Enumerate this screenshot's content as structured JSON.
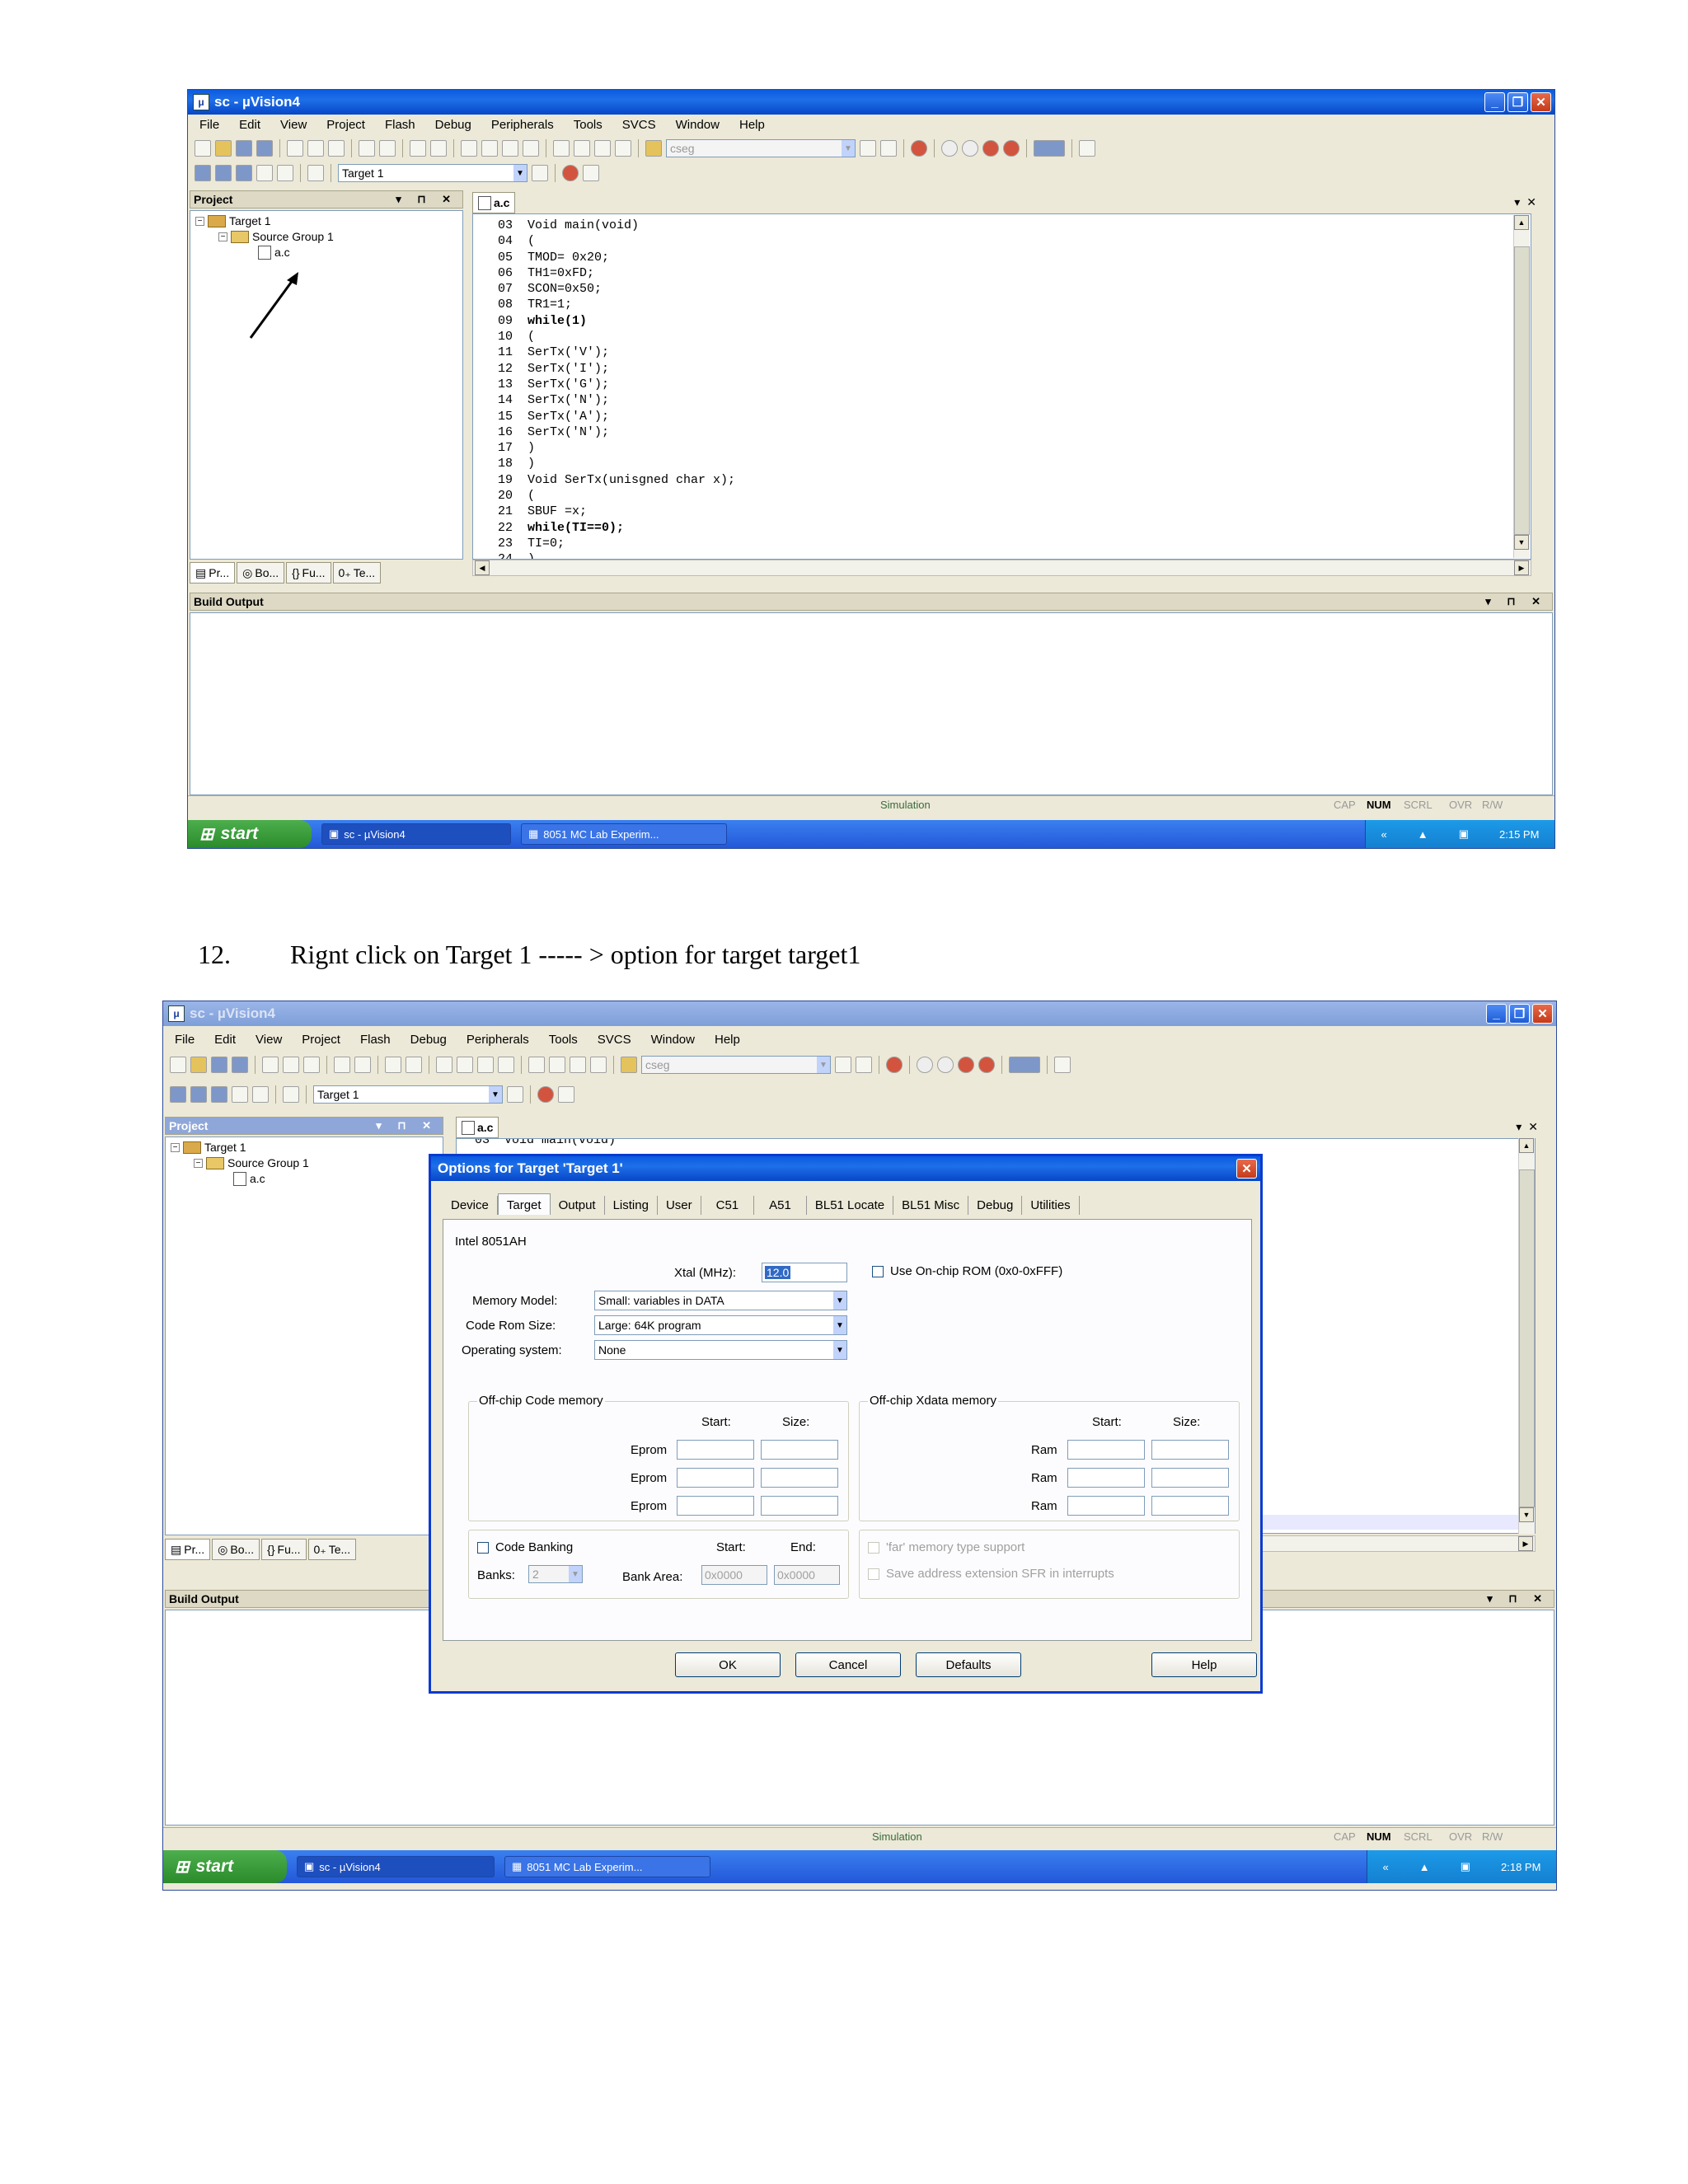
{
  "window": {
    "app_label": "sc",
    "title": "µVision4",
    "icon": "uvision-app-icon"
  },
  "menu": [
    "File",
    "Edit",
    "View",
    "Project",
    "Flash",
    "Debug",
    "Peripherals",
    "Tools",
    "SVCS",
    "Window",
    "Help"
  ],
  "toolbar": {
    "find_combo": "cseg",
    "target_combo": "Target 1"
  },
  "project_pane": {
    "title": "Project",
    "tree": {
      "target": "Target 1",
      "group": "Source Group 1",
      "file": "a.c"
    },
    "tabs": [
      "Pr...",
      "Bo...",
      "Fu...",
      "Te..."
    ]
  },
  "editor": {
    "tab": "a.c",
    "lines": [
      {
        "n": "03",
        "t": "Void main(void)"
      },
      {
        "n": "04",
        "t": "("
      },
      {
        "n": "05",
        "t": "TMOD= 0x20;"
      },
      {
        "n": "06",
        "t": "TH1=0xFD;"
      },
      {
        "n": "07",
        "t": "SCON=0x50;"
      },
      {
        "n": "08",
        "t": "TR1=1;"
      },
      {
        "n": "09",
        "t": "while(1)"
      },
      {
        "n": "10",
        "t": "("
      },
      {
        "n": "11",
        "t": "SerTx('V');"
      },
      {
        "n": "12",
        "t": "SerTx('I');"
      },
      {
        "n": "13",
        "t": "SerTx('G');"
      },
      {
        "n": "14",
        "t": "SerTx('N');"
      },
      {
        "n": "15",
        "t": "SerTx('A');"
      },
      {
        "n": "16",
        "t": "SerTx('N');"
      },
      {
        "n": "17",
        "t": ")"
      },
      {
        "n": "18",
        "t": ")"
      },
      {
        "n": "19",
        "t": "Void SerTx(unisgned char x);"
      },
      {
        "n": "20",
        "t": "("
      },
      {
        "n": "21",
        "t": "SBUF =x;"
      },
      {
        "n": "22",
        "t": "while(TI==0);"
      },
      {
        "n": "23",
        "t": "TI=0;"
      },
      {
        "n": "24",
        "t": ")"
      }
    ],
    "peek_line": "03  Void main(void)"
  },
  "build_output": {
    "title": "Build Output"
  },
  "status": {
    "mode": "Simulation",
    "indicators": [
      "CAP",
      "NUM",
      "SCRL",
      "OVR",
      "R/W"
    ]
  },
  "taskbar": {
    "start": "start",
    "tasks": [
      "sc - µVision4",
      "8051 MC Lab Experim..."
    ],
    "clock1": "2:15 PM",
    "clock2": "2:18 PM"
  },
  "instruction": {
    "number": "12.",
    "text": "Rignt click on Target 1 ----- >  option for target target1"
  },
  "dialog": {
    "title": "Options for Target 'Target 1'",
    "tabs": [
      "Device",
      "Target",
      "Output",
      "Listing",
      "User",
      "C51",
      "A51",
      "BL51 Locate",
      "BL51 Misc",
      "Debug",
      "Utilities"
    ],
    "device": "Intel 8051AH",
    "xtal_label": "Xtal (MHz):",
    "xtal_value": "12.0",
    "use_onchip_rom": "Use On-chip ROM (0x0-0xFFF)",
    "memory_model_label": "Memory Model:",
    "memory_model": "Small: variables in DATA",
    "code_rom_label": "Code Rom Size:",
    "code_rom": "Large: 64K program",
    "os_label": "Operating system:",
    "os": "None",
    "offchip_code_title": "Off-chip Code memory",
    "offchip_xdata_title": "Off-chip Xdata memory",
    "start_label": "Start:",
    "size_label": "Size:",
    "end_label": "End:",
    "eprom": [
      "Eprom",
      "Eprom",
      "Eprom"
    ],
    "ram": [
      "Ram",
      "Ram",
      "Ram"
    ],
    "code_banking": "Code Banking",
    "banks_label": "Banks:",
    "banks_value": "2",
    "bank_area_label": "Bank Area:",
    "bank_start": "0x0000",
    "bank_end": "0x0000",
    "far_memory": "'far' memory type support",
    "save_sfr": "Save address extension SFR in interrupts",
    "buttons": {
      "ok": "OK",
      "cancel": "Cancel",
      "defaults": "Defaults",
      "help": "Help"
    }
  }
}
